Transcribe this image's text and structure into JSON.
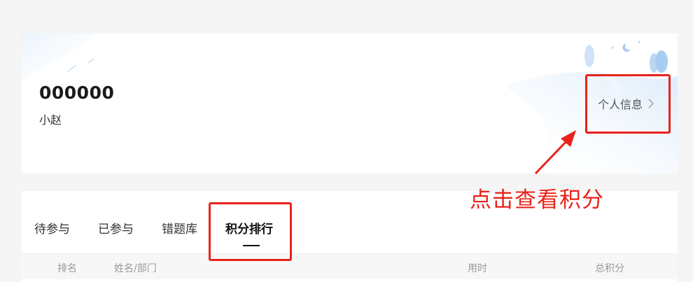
{
  "profile": {
    "user_id": "000000",
    "user_name": "小赵",
    "personal_info_label": "个人信息"
  },
  "tabs": [
    {
      "label": "待参与",
      "active": false
    },
    {
      "label": "已参与",
      "active": false
    },
    {
      "label": "错题库",
      "active": false
    },
    {
      "label": "积分排行",
      "active": true
    }
  ],
  "table": {
    "columns": [
      "排名",
      "姓名/部门",
      "用时",
      "总积分"
    ]
  },
  "annotation": {
    "text": "点击查看积分",
    "color": "#e8231a"
  },
  "icons": {
    "personal_info_chevron": "chevron-right-icon",
    "annotation_arrow": "arrow-icon"
  }
}
